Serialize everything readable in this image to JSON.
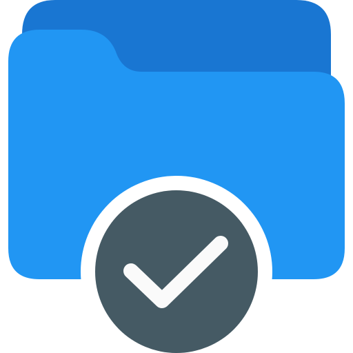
{
  "icon": {
    "name": "folder-check-icon",
    "colors": {
      "folder_back": "#1976D2",
      "folder_front": "#2196F3",
      "badge_ring": "#FFFFFF",
      "badge_fill": "#455A64",
      "check_mark": "#FAFAFA",
      "background": "#FFFFFF"
    }
  }
}
